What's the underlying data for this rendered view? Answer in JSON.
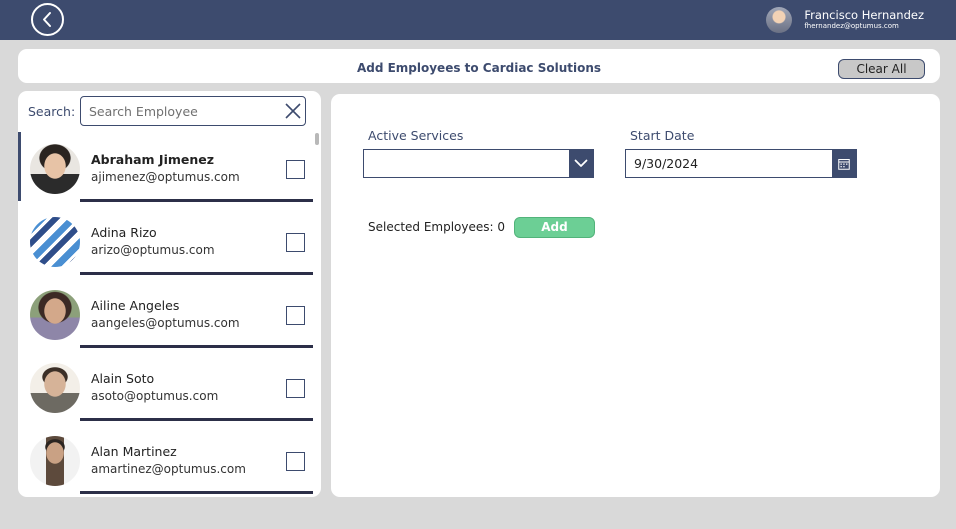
{
  "header": {
    "back_icon": "chevron-left-icon",
    "user": {
      "name": "Francisco Hernandez",
      "email": "fhernandez@optumus.com"
    }
  },
  "titlebar": {
    "title": "Add Employees to Cardiac Solutions",
    "clear_all_label": "Clear All"
  },
  "search": {
    "label": "Search:",
    "placeholder": "Search Employee",
    "value": "",
    "clear_icon": "close-icon"
  },
  "employees": [
    {
      "name": "Abraham Jimenez",
      "email": "ajimenez@optumus.com",
      "checked": false,
      "selected": true
    },
    {
      "name": "Adina Rizo",
      "email": "arizo@optumus.com",
      "checked": false,
      "selected": false
    },
    {
      "name": "Ailine Angeles",
      "email": "aangeles@optumus.com",
      "checked": false,
      "selected": false
    },
    {
      "name": "Alain Soto",
      "email": "asoto@optumus.com",
      "checked": false,
      "selected": false
    },
    {
      "name": "Alan Martinez",
      "email": "amartinez@optumus.com",
      "checked": false,
      "selected": false
    }
  ],
  "form": {
    "active_services_label": "Active Services",
    "active_services_value": "",
    "start_date_label": "Start Date",
    "start_date_value": "9/30/2024",
    "selected_employees_text": "Selected Employees: 0",
    "add_label": "Add"
  },
  "colors": {
    "primary": "#3d4b6e",
    "add_button": "#6ccf95",
    "background": "#d9d9d9",
    "separator": "#2c2f48"
  }
}
